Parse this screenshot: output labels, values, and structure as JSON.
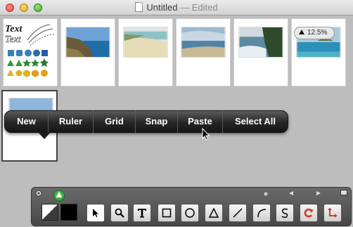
{
  "window": {
    "title": "Untitled",
    "status": "— Edited"
  },
  "thumbnails": [
    {
      "name": "shapes-sampler"
    },
    {
      "name": "coast-bay"
    },
    {
      "name": "beach-dunes"
    },
    {
      "name": "shore-horizon"
    },
    {
      "name": "cliff-waves"
    },
    {
      "name": "lagoon"
    },
    {
      "name": "sky-sea"
    }
  ],
  "shapes_sampler": {
    "text_line_1": "Text",
    "text_line_2": "Text"
  },
  "zoom_badge": {
    "value": "12.5%"
  },
  "context_menu": {
    "items": [
      "New",
      "Ruler",
      "Grid",
      "Snap",
      "Paste",
      "Select All"
    ]
  },
  "tools": [
    "pointer",
    "zoom",
    "text",
    "rectangle",
    "ellipse",
    "triangle",
    "line",
    "arc",
    "freehand",
    "rotate",
    "crop"
  ],
  "colors": {
    "stroke_swatch": "#ffffff",
    "fill_swatch": "#000000",
    "accent_green": "#3cb043",
    "rotate_red": "#d33a2c"
  }
}
